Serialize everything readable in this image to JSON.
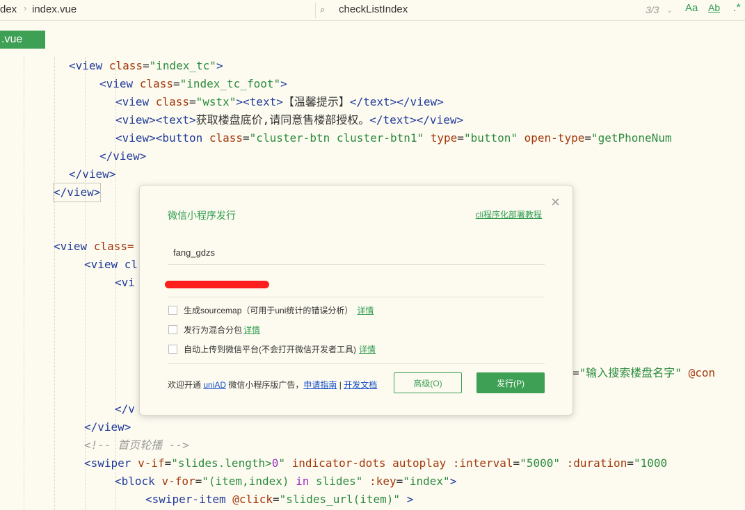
{
  "topbar": {
    "crumb1": "dex",
    "crumb2": "index.vue",
    "symbol": "checkListIndex",
    "match_count": "3/3",
    "icon_aa": "Aa",
    "icon_ab": "Ab"
  },
  "file_tab": ".vue",
  "code": {
    "l1": [
      "<view ",
      "class",
      "=",
      "\"index_tc\"",
      ">"
    ],
    "l2": [
      "<view ",
      "class",
      "=",
      "\"index_tc_foot\"",
      ">"
    ],
    "l3": [
      "<view ",
      "class",
      "=",
      "\"wstx\"",
      "><text>",
      "【温馨提示】",
      "</text></view>"
    ],
    "l4": [
      "<view><text>",
      "获取楼盘底价,请同意售楼部授权。",
      "</text></view>"
    ],
    "l5": [
      "<view><button ",
      "class",
      "=",
      "\"cluster-btn cluster-btn1\"",
      " ",
      "type",
      "=",
      "\"button\"",
      " ",
      "open-type",
      "=",
      "\"getPhoneNum"
    ],
    "l6": "</view>",
    "l7": "</view>",
    "l8": "</view>",
    "l9": [
      "<view ",
      "class="
    ],
    "l10": "<view cl",
    "l11": "<vi",
    "l12": [
      "=",
      "\"输入搜索楼盘名字\"",
      " ",
      "@con"
    ],
    "l13": "</v",
    "l14": "</view>",
    "l15": "<!-- 首页轮播 -->",
    "l16": [
      "<swiper ",
      "v-if",
      "=",
      "\"slides.length>",
      "0",
      "\"",
      " indicator-dots autoplay ",
      ":interval",
      "=",
      "\"5000\"",
      " ",
      ":duration",
      "=",
      "\"1000"
    ],
    "l17": [
      "<block ",
      "v-for",
      "=",
      "\"(item,index) ",
      "in",
      " slides\"",
      " ",
      ":key",
      "=",
      "\"index\"",
      ">"
    ],
    "l18": [
      "<swiper-item ",
      "@click",
      "=",
      "\"slides_url(item)\"",
      " >"
    ]
  },
  "dialog": {
    "title": "微信小程序发行",
    "doc_link": "cli程序化部署教程",
    "appid": "fang_gdzs",
    "options": [
      {
        "label": "生成sourcemap（可用于uni统计的错误分析）",
        "link": "详情",
        "checked": false
      },
      {
        "label": "发行为混合分包",
        "link": "详情",
        "checked": false
      },
      {
        "label": "自动上传到微信平台(不会打开微信开发者工具)",
        "link": "详情",
        "checked": false
      }
    ],
    "footer_prefix": "欢迎开通 ",
    "footer_link1": "uniAD",
    "footer_mid": " 微信小程序版广告，",
    "footer_link2": "申请指南",
    "footer_bar": " | ",
    "footer_link3": "开发文档",
    "advanced_button": "高级(O)",
    "publish_button": "发行(P)"
  }
}
